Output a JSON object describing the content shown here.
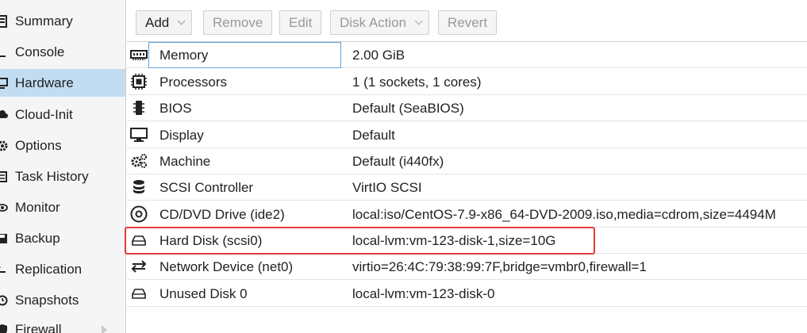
{
  "sidebar": {
    "items": [
      {
        "label": "Summary",
        "icon": "summary-icon"
      },
      {
        "label": "Console",
        "icon": "console-icon"
      },
      {
        "label": "Hardware",
        "icon": "hardware-icon",
        "active": true
      },
      {
        "label": "Cloud-Init",
        "icon": "cloud-icon"
      },
      {
        "label": "Options",
        "icon": "gear-icon"
      },
      {
        "label": "Task History",
        "icon": "list-icon"
      },
      {
        "label": "Monitor",
        "icon": "eye-icon"
      },
      {
        "label": "Backup",
        "icon": "floppy-icon"
      },
      {
        "label": "Replication",
        "icon": "retweet-icon"
      },
      {
        "label": "Snapshots",
        "icon": "history-icon"
      },
      {
        "label": "Firewall",
        "icon": "shield-icon"
      }
    ]
  },
  "toolbar": {
    "add": "Add",
    "remove": "Remove",
    "edit": "Edit",
    "disk_action": "Disk Action",
    "revert": "Revert"
  },
  "hardware": {
    "rows": [
      {
        "key": "Memory",
        "value": "2.00 GiB",
        "icon": "memory-icon"
      },
      {
        "key": "Processors",
        "value": "1 (1 sockets, 1 cores)",
        "icon": "cpu-icon"
      },
      {
        "key": "BIOS",
        "value": "Default (SeaBIOS)",
        "icon": "microchip-icon"
      },
      {
        "key": "Display",
        "value": "Default",
        "icon": "desktop-icon"
      },
      {
        "key": "Machine",
        "value": "Default (i440fx)",
        "icon": "cogs-icon"
      },
      {
        "key": "SCSI Controller",
        "value": "VirtIO SCSI",
        "icon": "database-icon"
      },
      {
        "key": "CD/DVD Drive (ide2)",
        "value": "local:iso/CentOS-7.9-x86_64-DVD-2009.iso,media=cdrom,size=4494M",
        "icon": "cdrom-icon"
      },
      {
        "key": "Hard Disk (scsi0)",
        "value": "local-lvm:vm-123-disk-1,size=10G",
        "icon": "hdd-icon"
      },
      {
        "key": "Network Device (net0)",
        "value": "virtio=26:4C:79:38:99:7F,bridge=vmbr0,firewall=1",
        "icon": "exchange-icon"
      },
      {
        "key": "Unused Disk 0",
        "value": "local-lvm:vm-123-disk-0",
        "icon": "hdd-icon"
      }
    ]
  },
  "colors": {
    "active_nav": "#c2ddf2",
    "focus_border": "#5fa2dd",
    "highlight_border": "#e23b3b"
  }
}
